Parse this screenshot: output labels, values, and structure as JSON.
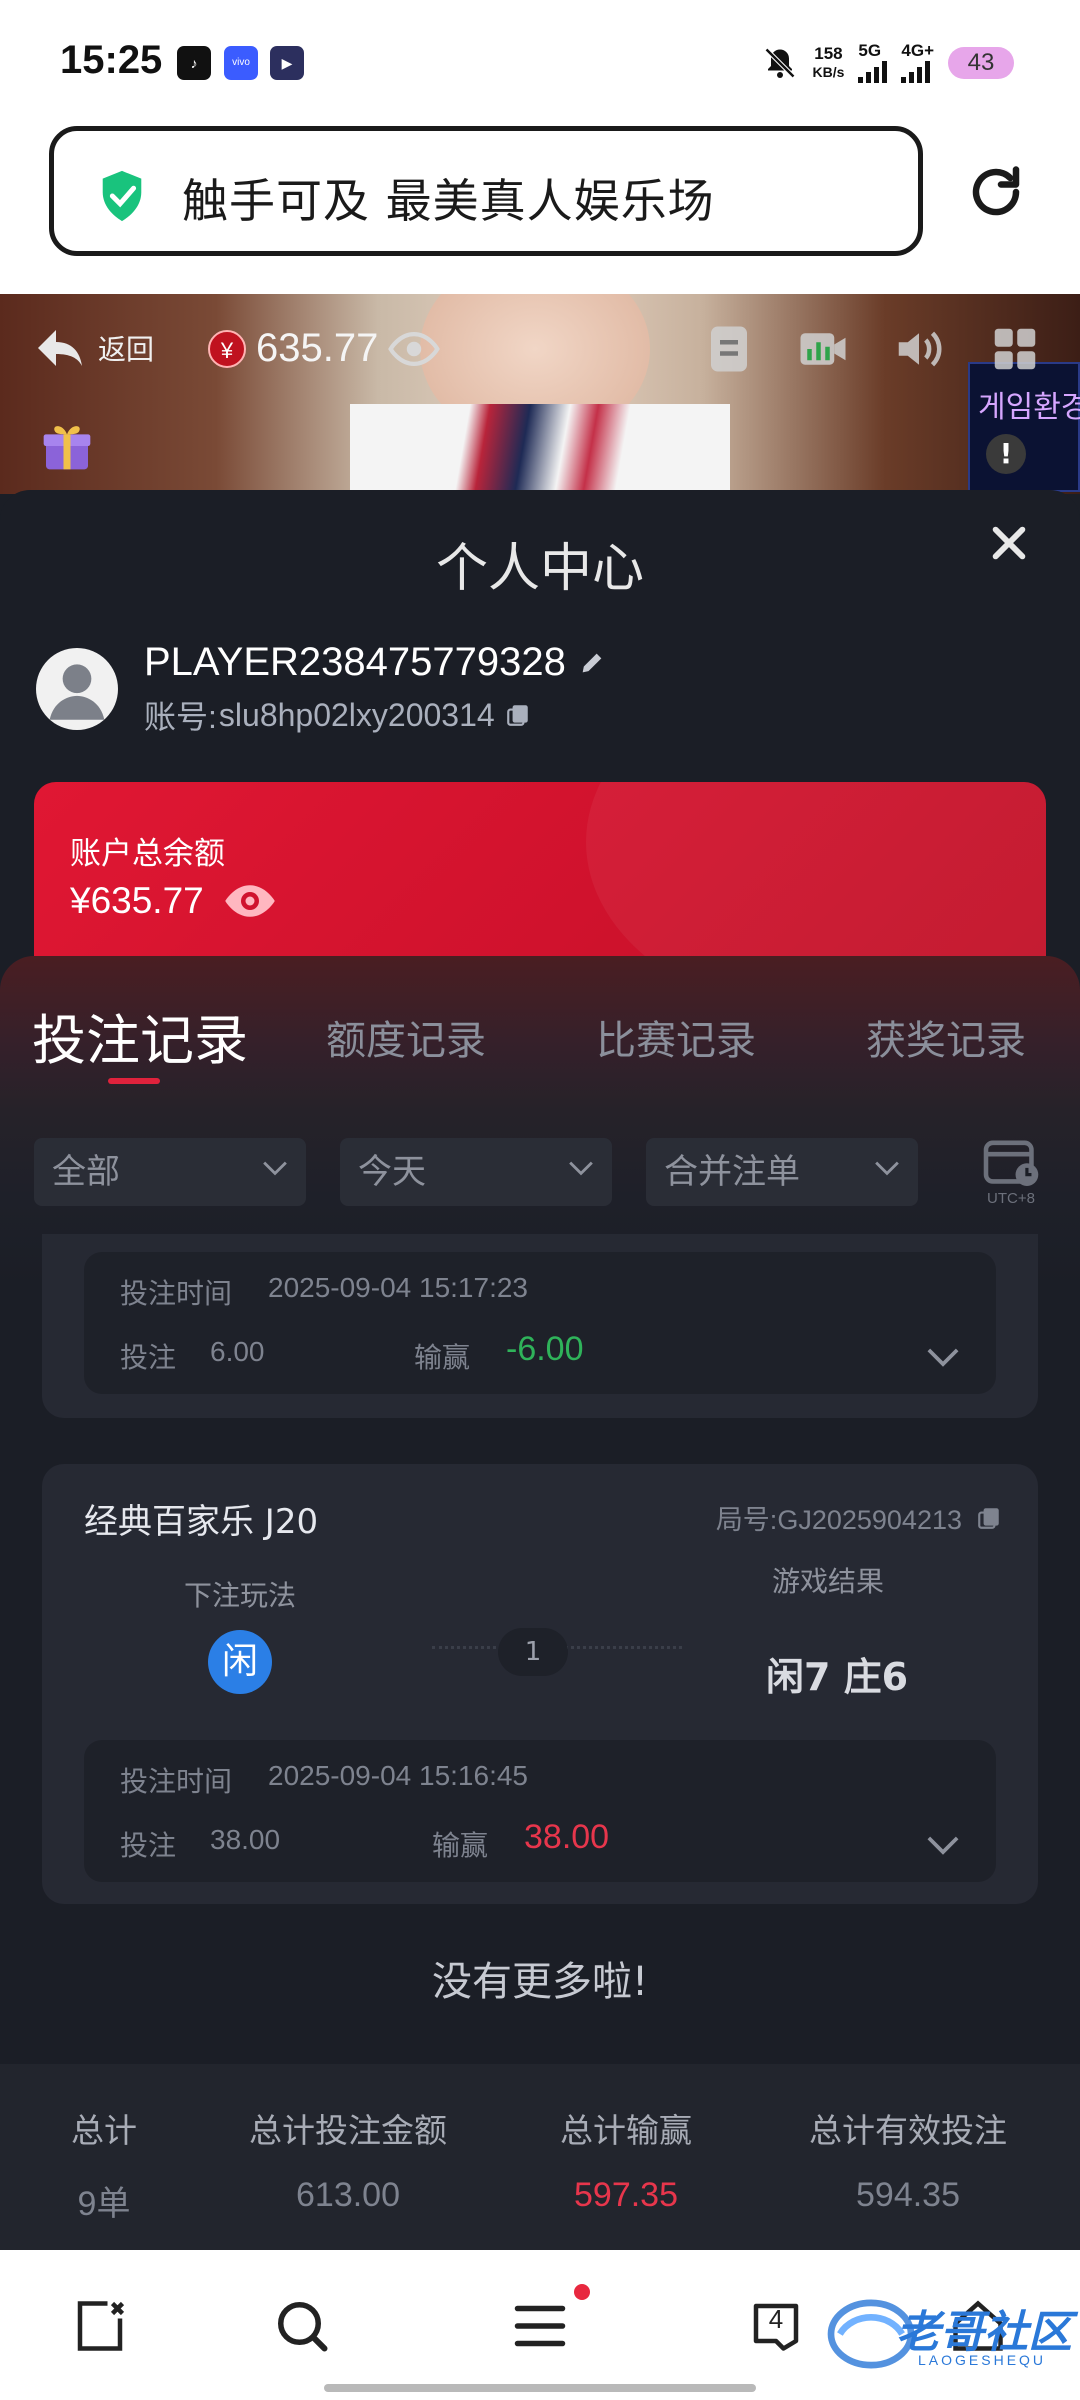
{
  "status_bar": {
    "time": "15:25",
    "speed_value": "158",
    "speed_unit": "KB/s",
    "net1": "5G",
    "net2": "4G+",
    "battery": "43",
    "icons": [
      "app-icon",
      "vivo-icon",
      "video-app-icon",
      "mute-bell-icon"
    ]
  },
  "url_bar": {
    "title": "触手可及 最美真人娱乐场",
    "shield_color": "#19c37d"
  },
  "video_overlay": {
    "back_label": "返回",
    "balance": "635.77",
    "coin_symbol": "¥",
    "sign_text": "게임환경",
    "warn_symbol": "!"
  },
  "panel": {
    "title": "个人中心",
    "player_name": "PLAYER238475779328",
    "account_prefix": "账号:",
    "account_id": "slu8hp02lxy200314",
    "balance_label": "账户总余额",
    "balance_currency": "¥",
    "balance_value": "635.77"
  },
  "tabs": [
    {
      "label": "投注记录",
      "active": true
    },
    {
      "label": "额度记录",
      "active": false
    },
    {
      "label": "比赛记录",
      "active": false
    },
    {
      "label": "获奖记录",
      "active": false
    }
  ],
  "filters": {
    "type": "全部",
    "date": "今天",
    "merge": "合并注单",
    "timezone": "UTC+8"
  },
  "records": [
    {
      "bet_time_label": "投注时间",
      "bet_time": "2025-09-04 15:17:23",
      "bet_label": "投注",
      "bet_amount": "6.00",
      "winloss_label": "输赢",
      "winloss": "-6.00"
    },
    {
      "game": "经典百家乐 J20",
      "round_label": "局号:",
      "round_id": "GJ2025904213",
      "play_label": "下注玩法",
      "result_label": "游戏结果",
      "bet_choice": "闲",
      "count": "1",
      "result": "闲7 庄6",
      "bet_time_label": "投注时间",
      "bet_time": "2025-09-04 15:16:45",
      "bet_label": "投注",
      "bet_amount": "38.00",
      "winloss_label": "输赢",
      "winloss": "38.00"
    }
  ],
  "no_more": "没有更多啦!",
  "totals": {
    "count_label": "总计",
    "count_value": "9单",
    "bet_label": "总计投注金额",
    "bet_value": "613.00",
    "winloss_label": "总计输赢",
    "winloss_value": "597.35",
    "valid_label": "总计有效投注",
    "valid_value": "594.35"
  },
  "nav": {
    "tabs_badge": "4",
    "watermark": "老哥社区",
    "watermark_sub": "LAOGESHEQU"
  }
}
